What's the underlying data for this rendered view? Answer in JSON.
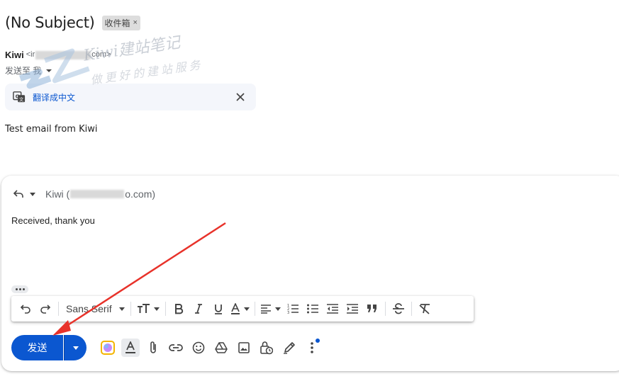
{
  "message": {
    "subject": "(No Subject)",
    "label_chip": "收件箱",
    "label_close": "×",
    "sender_name": "Kiwi",
    "sender_email_prefix": "<ir",
    "sender_email_suffix": "com>",
    "to_label": "发送至 我",
    "translate_label": "翻译成中文",
    "body": "Test email from Kiwi"
  },
  "watermark": {
    "line1": "Kiwi建站笔记",
    "line2": "做更好的建站服务"
  },
  "reply": {
    "to_name": "Kiwi (",
    "to_suffix": "o.com)",
    "body": "Received, thank you"
  },
  "toolbar": {
    "font_name": "Sans Serif"
  },
  "actions": {
    "send_label": "发送"
  },
  "colors": {
    "accent": "#0b57d0",
    "annotation_arrow": "#e8322a"
  }
}
